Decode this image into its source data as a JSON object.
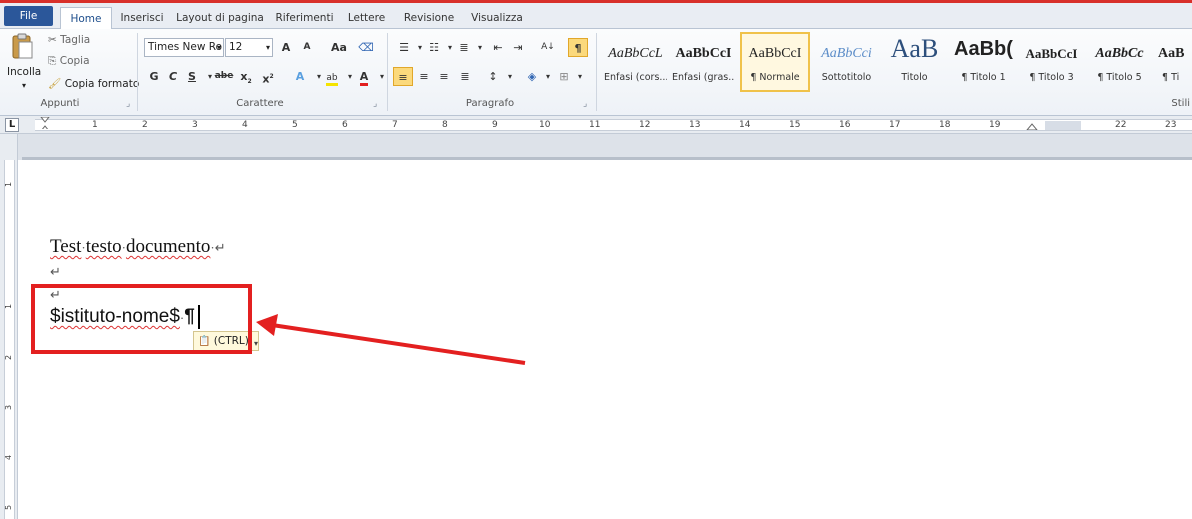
{
  "tabs": [
    {
      "label": "File"
    },
    {
      "label": "Home"
    },
    {
      "label": "Inserisci"
    },
    {
      "label": "Layout di pagina"
    },
    {
      "label": "Riferimenti"
    },
    {
      "label": "Lettere"
    },
    {
      "label": "Revisione"
    },
    {
      "label": "Visualizza"
    }
  ],
  "ribbon": {
    "clipboard": {
      "paste_label": "Incolla",
      "cut_label": "Taglia",
      "copy_label": "Copia",
      "format_painter_label": "Copia formato",
      "group_label": "Appunti"
    },
    "font": {
      "font_name": "Times New Ro",
      "font_size": "12",
      "grow": "A",
      "shrink": "A",
      "change_case": "Aa",
      "bold": "G",
      "italic": "C",
      "underline": "S",
      "strike": "abe",
      "subscript": "x",
      "superscript": "x",
      "group_label": "Carattere"
    },
    "paragraph": {
      "group_label": "Paragrafo",
      "sort": "A↓",
      "pilcrow": "¶"
    },
    "styles": {
      "group_label": "Stili",
      "items": [
        {
          "sample": "AaBbCcL",
          "name": "Enfasi (cors..."
        },
        {
          "sample": "AaBbCcI",
          "name": "Enfasi (gras..."
        },
        {
          "sample": "AaBbCcI",
          "name": "¶ Normale"
        },
        {
          "sample": "AaBbCci",
          "name": "Sottotitolo"
        },
        {
          "sample": "AaB",
          "name": "Titolo"
        },
        {
          "sample": "AaBb(",
          "name": "¶ Titolo 1"
        },
        {
          "sample": "AaBbCcI",
          "name": "¶ Titolo 3"
        },
        {
          "sample": "AaBbCc",
          "name": "¶ Titolo 5"
        },
        {
          "sample": "AaB",
          "name": "¶ Ti"
        }
      ]
    }
  },
  "ruler": {
    "tab_selector": "L",
    "numbers": [
      "1",
      "2",
      "3",
      "4",
      "5",
      "6",
      "7",
      "8",
      "9",
      "10",
      "11",
      "12",
      "13",
      "14",
      "15",
      "16",
      "17",
      "18",
      "19",
      "22",
      "23"
    ]
  },
  "vruler": {
    "numbers": [
      "1",
      "1",
      "2",
      "3",
      "4",
      "5"
    ]
  },
  "document": {
    "line1_word1": "Test",
    "line1_word2": "testo",
    "line1_word3": "documento",
    "dot": "·",
    "return_mark": "↵",
    "line4_text": "$istituto-nome$",
    "pilcrow": "¶",
    "paste_options_label": "(CTRL)",
    "paste_options_icon": "📋",
    "dropdown_arrow": "▾"
  },
  "annotation": {
    "color": "#e32020"
  }
}
